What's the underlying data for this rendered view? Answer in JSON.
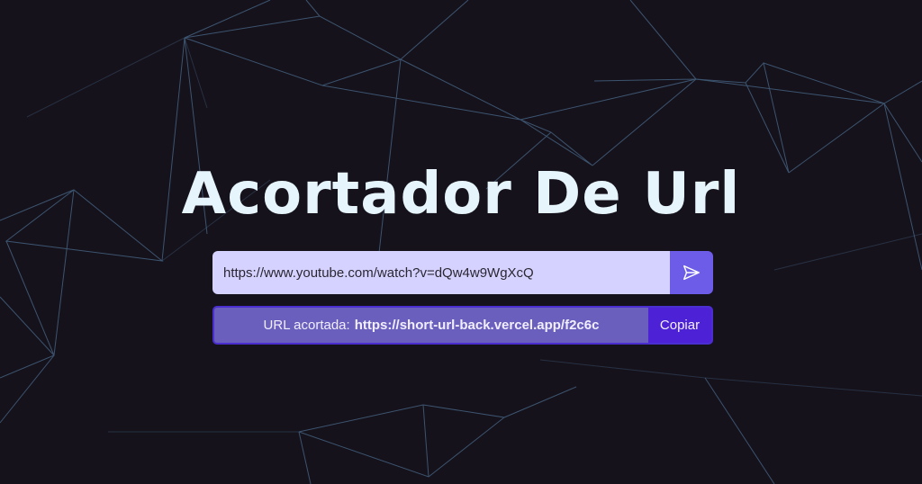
{
  "title": "Acortador De Url",
  "form": {
    "url_value": "https://www.youtube.com/watch?v=dQw4w9WgXcQ",
    "send_icon": "paper-plane-icon"
  },
  "result": {
    "label": "URL acortada:",
    "short_url": "https://short-url-back.vercel.app/f2c6c",
    "copy_label": "Copiar"
  },
  "colors": {
    "background": "#15121b",
    "network_lines": "#4a6a8c",
    "title": "#e6f4fb",
    "input_bg": "#d5d2ff",
    "send_button": "#6c5ce7",
    "result_bg": "#6a5fbd",
    "result_border": "#4b2ed0",
    "copy_button": "#4d21d6"
  }
}
